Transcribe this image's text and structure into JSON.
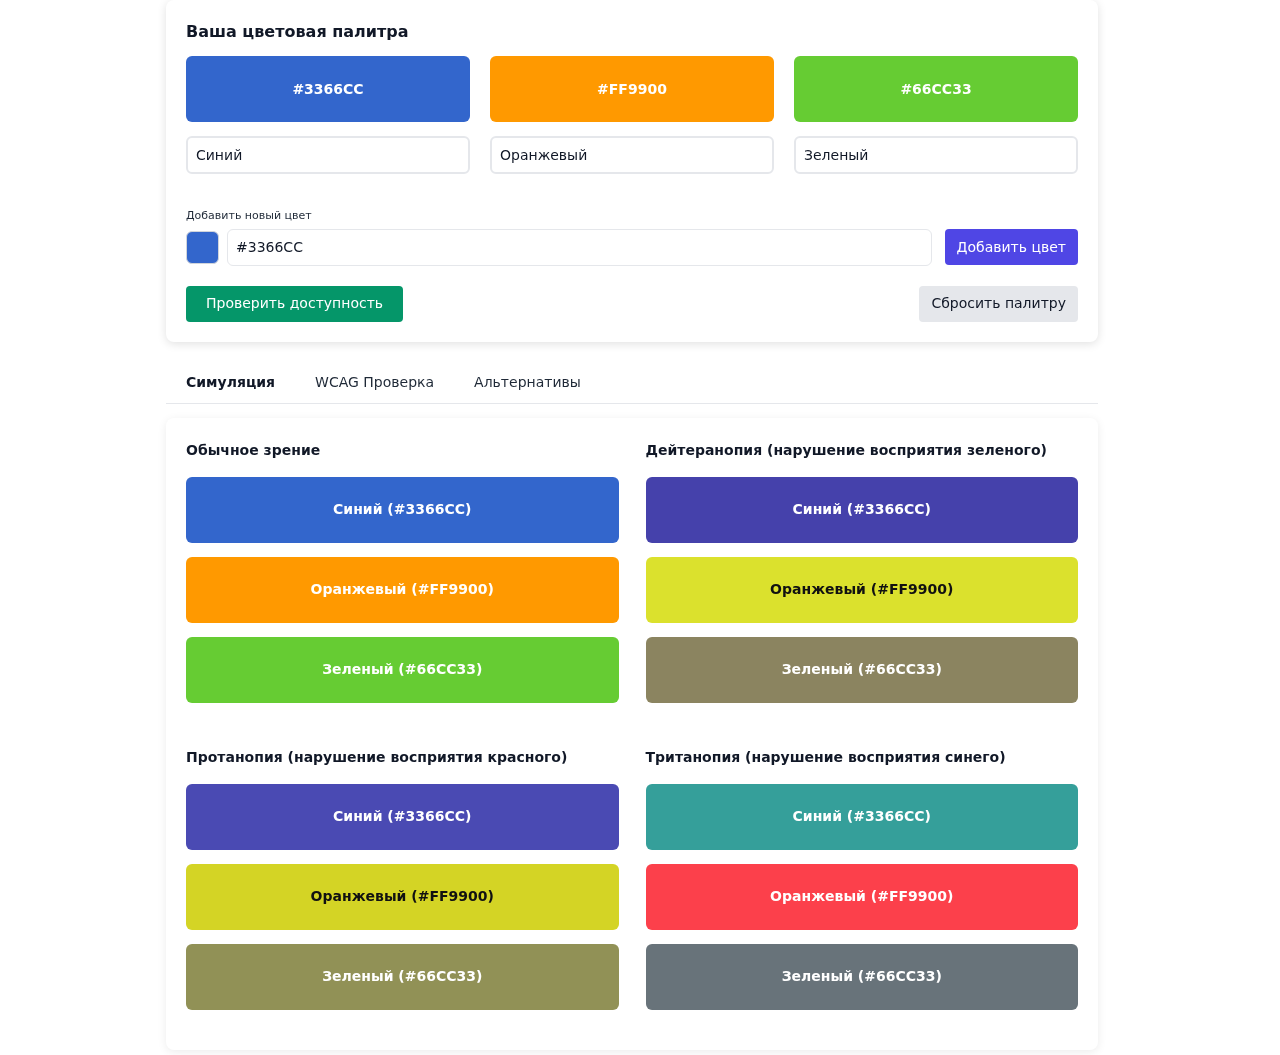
{
  "palette": {
    "title": "Ваша цветовая палитра",
    "colors": [
      {
        "hex": "#3366CC",
        "color": "#3366cc",
        "name": "Синий"
      },
      {
        "hex": "#FF9900",
        "color": "#ff9900",
        "name": "Оранжевый"
      },
      {
        "hex": "#66CC33",
        "color": "#66cc33",
        "name": "Зеленый"
      }
    ],
    "add_label": "Добавить новый цвет",
    "add_value": "#3366CC",
    "add_button": "Добавить цвет",
    "check_button": "Проверить доступность",
    "reset_button": "Сбросить палитру"
  },
  "tabs": [
    {
      "label": "Симуляция",
      "selected": true
    },
    {
      "label": "WCAG Проверка",
      "selected": false
    },
    {
      "label": "Альтернативы",
      "selected": false
    }
  ],
  "simulations": [
    {
      "title": "Обычное зрение",
      "swatches": [
        {
          "label": "Синий (#3366CC)",
          "color": "#3366cc",
          "kind": "light"
        },
        {
          "label": "Оранжевый (#FF9900)",
          "color": "#ff9900",
          "kind": "light"
        },
        {
          "label": "Зеленый (#66CC33)",
          "color": "#66cc33",
          "kind": "light"
        }
      ]
    },
    {
      "title": "Дейтеранопия (нарушение восприятия зеленого)",
      "swatches": [
        {
          "label": "Синий (#3366CC)",
          "color": "#4541ab",
          "kind": "light"
        },
        {
          "label": "Оранжевый (#FF9900)",
          "color": "#dbe12d",
          "kind": "dark"
        },
        {
          "label": "Зеленый (#66CC33)",
          "color": "#8b8460",
          "kind": "light"
        }
      ]
    },
    {
      "title": "Протанопия (нарушение восприятия красного)",
      "swatches": [
        {
          "label": "Синий (#3366CC)",
          "color": "#4a4ab3",
          "kind": "light"
        },
        {
          "label": "Оранжевый (#FF9900)",
          "color": "#d4d425",
          "kind": "dark"
        },
        {
          "label": "Зеленый (#66CC33)",
          "color": "#919156",
          "kind": "light"
        }
      ]
    },
    {
      "title": "Тританопия (нарушение восприятия синего)",
      "swatches": [
        {
          "label": "Синий (#3366CC)",
          "color": "#359f9a",
          "kind": "light"
        },
        {
          "label": "Оранжевый (#FF9900)",
          "color": "#fc404b",
          "kind": "light"
        },
        {
          "label": "Зеленый (#66CC33)",
          "color": "#68737a",
          "kind": "light"
        }
      ]
    }
  ]
}
